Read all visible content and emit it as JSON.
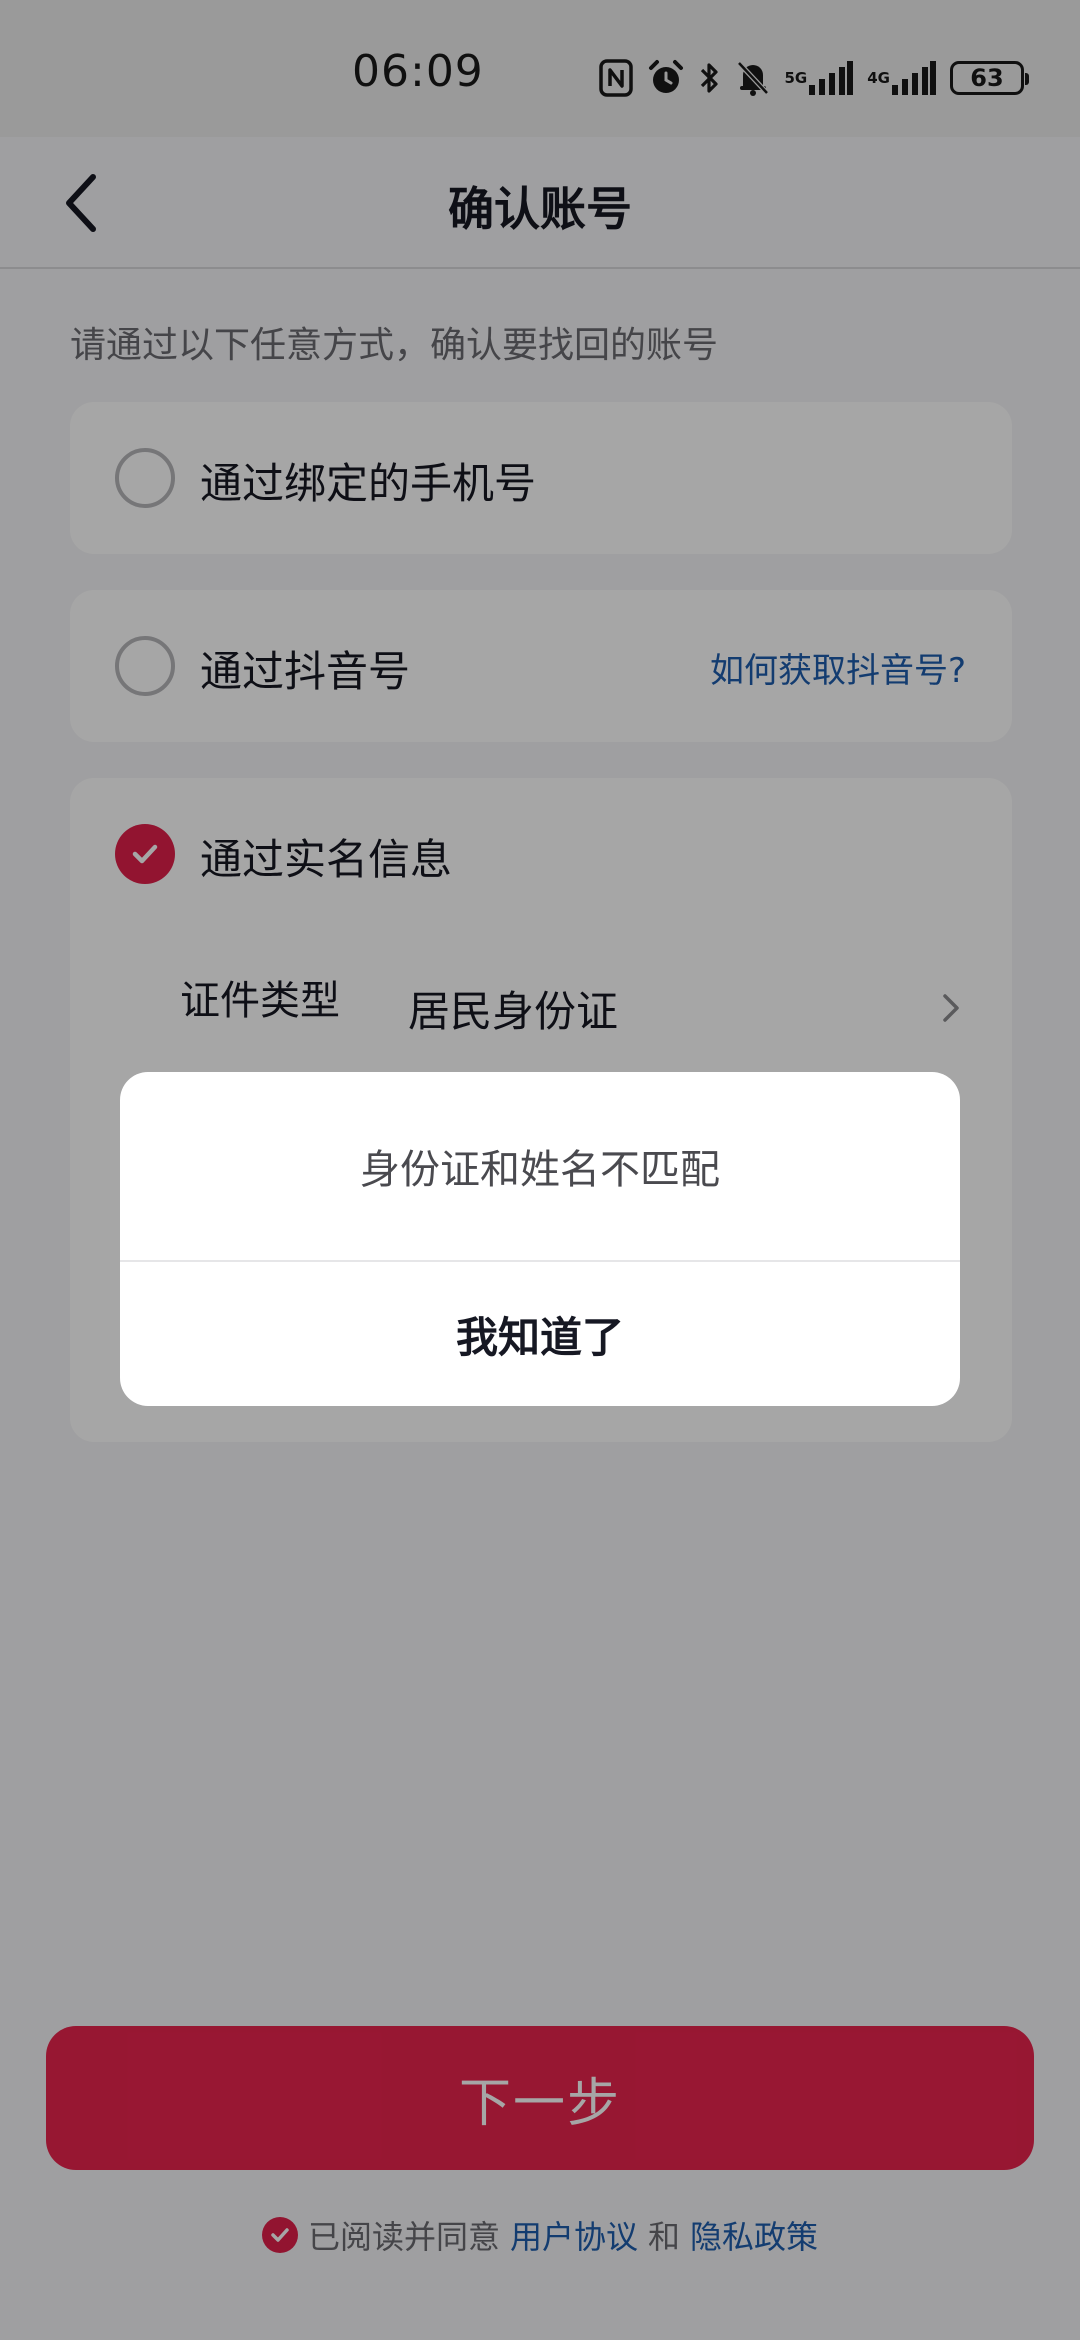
{
  "status_bar": {
    "time": "06:09",
    "network_5g": "5G",
    "network_4g": "4G",
    "battery": "63"
  },
  "header": {
    "title": "确认账号"
  },
  "instruction": "请通过以下任意方式，确认要找回的账号",
  "options": [
    {
      "label": "通过绑定的手机号",
      "selected": false
    },
    {
      "label": "通过抖音号",
      "selected": false,
      "help_link": "如何获取抖音号?"
    },
    {
      "label": "通过实名信息",
      "selected": true
    }
  ],
  "realname": {
    "field_label": "证件类型",
    "field_value": "居民身份证"
  },
  "next_button": "下一步",
  "agreement": {
    "prefix": "已阅读并同意",
    "user_agreement": "用户协议",
    "and": "和",
    "privacy_policy": "隐私政策",
    "checked": true
  },
  "dialog": {
    "message": "身份证和姓名不匹配",
    "confirm": "我知道了"
  },
  "colors": {
    "accent": "#e9244e",
    "link": "#1e5dad"
  }
}
